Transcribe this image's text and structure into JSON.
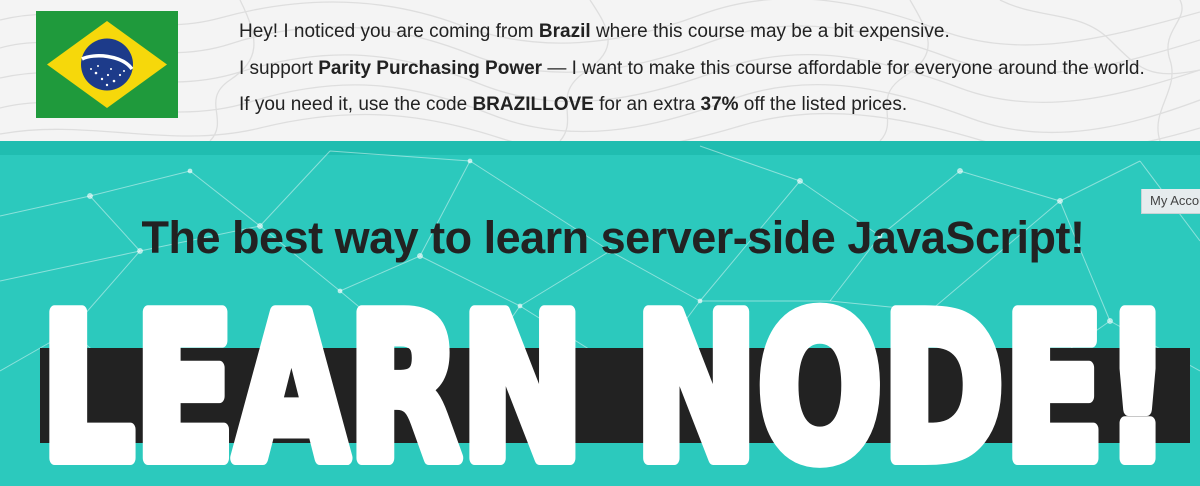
{
  "banner": {
    "flag_country": "Brazil",
    "line1": {
      "pre": "Hey! I noticed you are coming from ",
      "country": "Brazil",
      "post": " where this course may be a bit expensive."
    },
    "line2": {
      "pre": "I support ",
      "ppp": "Parity Purchasing Power",
      "post": " — I want to make this course affordable for everyone around the world."
    },
    "line3": {
      "pre": "If you need it, use the code ",
      "code": "BRAZILLOVE",
      "mid": " for an extra ",
      "percent": "37%",
      "post": " off the listed prices."
    }
  },
  "hero": {
    "account_link": "My Account",
    "tagline": "The best way to learn server-side JavaScript!",
    "title": "LEARN NODE!"
  },
  "colors": {
    "hero_bg": "#2cc9bd",
    "banner_bg": "#f4f4f4",
    "flag_green": "#1f9a3c",
    "flag_yellow": "#f6d80b",
    "flag_blue": "#1d3b8a",
    "title_bar": "#222222"
  },
  "icons": {
    "flag": "brazil-flag-icon"
  }
}
